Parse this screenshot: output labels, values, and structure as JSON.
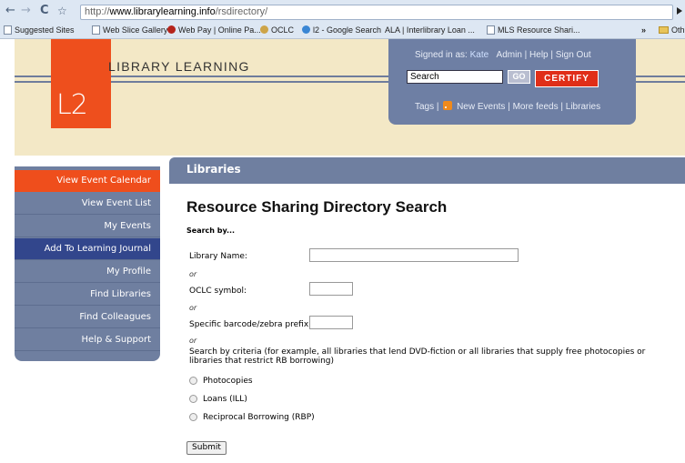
{
  "browser": {
    "url_prefix": "http://",
    "url_host": "www.librarylearning.info",
    "url_path": "/rsdirectory/",
    "bookmarks": [
      {
        "label": "Suggested Sites",
        "icon": "page-icon"
      },
      {
        "label": "Web Slice Gallery",
        "icon": "page-icon"
      },
      {
        "label": "Web Pay | Online Pa...",
        "icon": "webpay-icon"
      },
      {
        "label": "OCLC",
        "icon": "oclc-icon"
      },
      {
        "label": "l2 - Google Search",
        "icon": "google-icon"
      },
      {
        "label": "ALA | Interlibrary Loan ...",
        "icon": "none"
      },
      {
        "label": "MLS Resource Shari...",
        "icon": "page-icon"
      },
      {
        "label": "»",
        "icon": "none"
      },
      {
        "label": "Oth",
        "icon": "folder-icon"
      }
    ]
  },
  "header": {
    "logo_text": "L2",
    "site_title": "LIBRARY LEARNING"
  },
  "login": {
    "signed_in_label": "Signed in as:",
    "user": "Kate",
    "links": "Admin | Help | Sign Out",
    "search_value": "Search",
    "go_label": "GO",
    "certify_label": "CERTIFY",
    "tags_label": "Tags",
    "new_events_label": "New Events",
    "more_feeds_label": "More feeds",
    "libraries_label": "Libraries"
  },
  "sidebar": {
    "items": [
      {
        "label": "View Event Calendar",
        "state": "active"
      },
      {
        "label": "View Event List",
        "state": "normal"
      },
      {
        "label": "My Events",
        "state": "normal"
      },
      {
        "label": "Add To Learning Journal",
        "state": "dark"
      },
      {
        "label": "My Profile",
        "state": "normal"
      },
      {
        "label": "Find Libraries",
        "state": "normal"
      },
      {
        "label": "Find Colleagues",
        "state": "normal"
      },
      {
        "label": "Help & Support",
        "state": "normal"
      }
    ]
  },
  "main": {
    "section_title": "Libraries",
    "heading": "Resource Sharing Directory Search",
    "search_by": "Search by...",
    "library_name_label": "Library Name:",
    "or_label": "or",
    "oclc_label": "OCLC symbol:",
    "barcode_label": "Specific barcode/zebra prefix:",
    "criteria_text": "Search by criteria (for example, all libraries that lend DVD-fiction or all libraries that supply free photocopies or libraries that restrict RB borrowing)",
    "options": [
      "Photocopies",
      "Loans (ILL)",
      "Reciprocal Borrowing (RBP)"
    ],
    "submit_label": "Submit"
  },
  "colors": {
    "accent_orange": "#ef4e1c",
    "nav_blue": "#6f7fa0",
    "nav_dark": "#32468c",
    "header_cream": "#f3e8c6"
  }
}
